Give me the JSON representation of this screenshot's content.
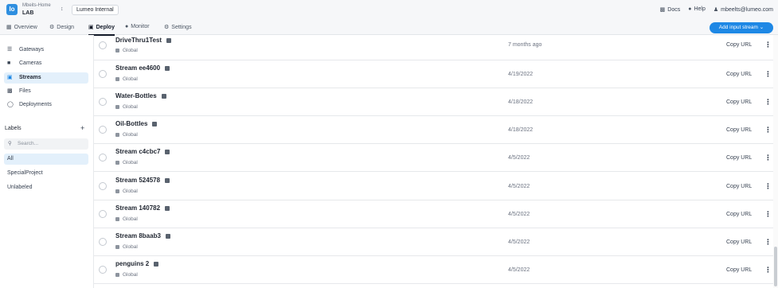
{
  "header": {
    "logo_glyph": "lo",
    "org_line1": "Mbeits-Home",
    "org_line2": "LAB",
    "workspace": "Lumeo Internal",
    "links": [
      {
        "icon": "book-icon",
        "label": "Docs"
      },
      {
        "icon": "help-icon",
        "label": "Help"
      },
      {
        "icon": "user-icon",
        "label": "mbeelts@lumeo.com"
      }
    ]
  },
  "nav": {
    "tabs": [
      {
        "label": "Overview",
        "icon": "grid-icon"
      },
      {
        "label": "Design",
        "icon": "design-icon"
      },
      {
        "label": "Deploy",
        "icon": "deploy-icon",
        "active": true
      },
      {
        "label": "Monitor",
        "icon": "monitor-icon"
      },
      {
        "label": "Settings",
        "icon": "gear-icon"
      }
    ],
    "add_button": "Add input stream"
  },
  "sidebar": {
    "items": [
      {
        "label": "Gateways",
        "icon": "gateway-icon"
      },
      {
        "label": "Cameras",
        "icon": "camera-icon"
      },
      {
        "label": "Streams",
        "icon": "stream-icon",
        "active": true
      },
      {
        "label": "Files",
        "icon": "file-icon"
      },
      {
        "label": "Deployments",
        "icon": "deployment-icon"
      }
    ],
    "labels_title": "Labels",
    "search_placeholder": "Search...",
    "labels": [
      {
        "label": "All",
        "active": true
      },
      {
        "label": "SpecialProject"
      },
      {
        "label": "Unlabeled"
      }
    ]
  },
  "streams": [
    {
      "name": "DriveThru1Test",
      "scope": "Global",
      "date": "7 months ago",
      "action": "Copy URL"
    },
    {
      "name": "Stream ee4600",
      "scope": "Global",
      "date": "4/19/2022",
      "action": "Copy URL"
    },
    {
      "name": "Water-Bottles",
      "scope": "Global",
      "date": "4/18/2022",
      "action": "Copy URL"
    },
    {
      "name": "Oil-Bottles",
      "scope": "Global",
      "date": "4/18/2022",
      "action": "Copy URL"
    },
    {
      "name": "Stream c4cbc7",
      "scope": "Global",
      "date": "4/5/2022",
      "action": "Copy URL"
    },
    {
      "name": "Stream 524578",
      "scope": "Global",
      "date": "4/5/2022",
      "action": "Copy URL"
    },
    {
      "name": "Stream 140782",
      "scope": "Global",
      "date": "4/5/2022",
      "action": "Copy URL"
    },
    {
      "name": "Stream 8baab3",
      "scope": "Global",
      "date": "4/5/2022",
      "action": "Copy URL"
    },
    {
      "name": "penguins 2",
      "scope": "Global",
      "date": "4/5/2022",
      "action": "Copy URL"
    }
  ],
  "colors": {
    "accent": "#1e88e5",
    "active_bg": "#e3f0fb"
  }
}
